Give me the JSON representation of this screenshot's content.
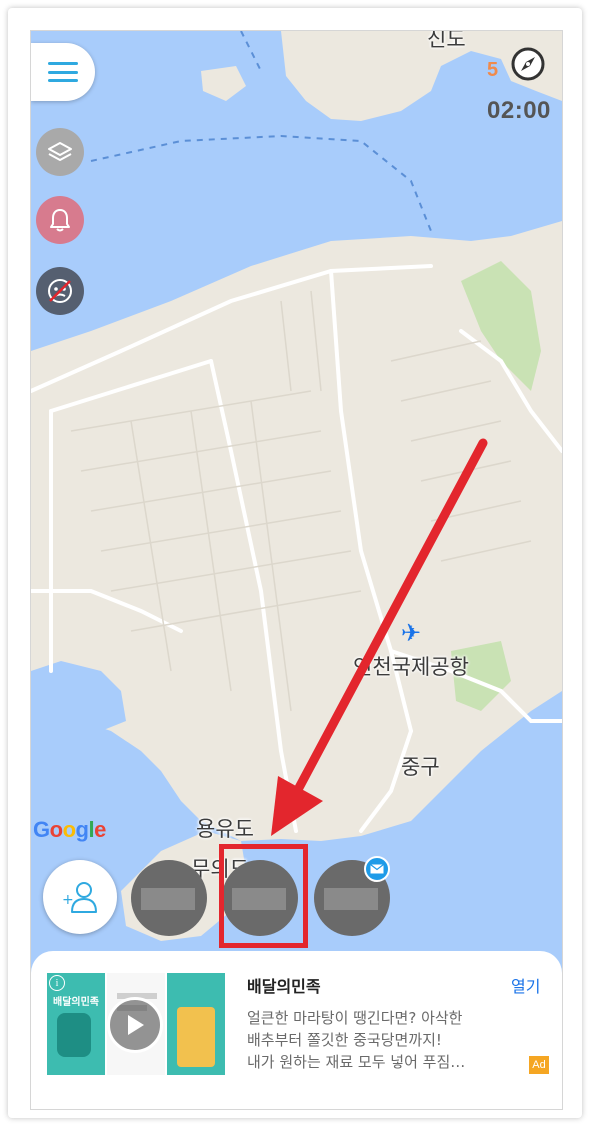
{
  "map": {
    "labels": {
      "airport": "인천국제공항",
      "district": "중구",
      "island": "용유도",
      "island2": "무의도",
      "top": "신도"
    },
    "google_logo": "Google",
    "colors": {
      "water": "#a8ccfb",
      "land": "#ece8df",
      "green": "#c9e2b4",
      "road": "#ffffff"
    }
  },
  "header": {
    "compass_count": "5",
    "timer": "02:00"
  },
  "icons": {
    "menu": "hamburger-menu-icon",
    "layers": "layers-icon",
    "notifications": "bell-icon",
    "no_location": "no-location-icon",
    "compass": "compass-icon",
    "add_friend": "add-friend-icon",
    "mail": "mail-icon",
    "airport": "airplane-icon",
    "play": "play-icon",
    "info": "info-icon"
  },
  "annotation": {
    "color": "#e3262d"
  },
  "ad": {
    "title": "배달의민족",
    "open_label": "열기",
    "body_lines": [
      "얼큰한 마라탕이 땡긴다면? 아삭한",
      "배추부터 쫄깃한 중국당면까지!",
      "내가 원하는 재료 모두 넣어 푸짐…"
    ],
    "badge": "Ad",
    "thumb_brand": "배달의민족"
  }
}
